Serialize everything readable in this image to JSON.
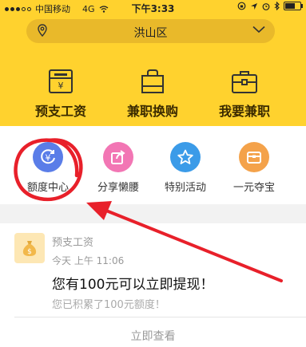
{
  "status_bar": {
    "carrier": "中国移动",
    "network": "4G",
    "time": "下午3:33"
  },
  "location": {
    "name": "洪山区"
  },
  "top_entries": [
    {
      "label": "预支工资",
      "icon": "wallet-icon"
    },
    {
      "label": "兼职换购",
      "icon": "shopping-bag-icon"
    },
    {
      "label": "我要兼职",
      "icon": "briefcase-icon"
    }
  ],
  "circle_entries": [
    {
      "label": "额度中心",
      "icon": "yen-refresh-icon",
      "color": "#5a7de8"
    },
    {
      "label": "分享懒腰",
      "icon": "share-icon",
      "color": "#f276b4"
    },
    {
      "label": "特别活动",
      "icon": "star-icon",
      "color": "#3b9be8"
    },
    {
      "label": "一元夺宝",
      "icon": "treasure-icon",
      "color": "#f4a24a"
    }
  ],
  "message": {
    "title": "预支工资",
    "time": "今天 上午 11:06",
    "headline": "您有100元可以立即提现！",
    "sub": "您已积累了100元额度！",
    "action": "立即查看"
  },
  "colors": {
    "brand_yellow": "#ffd22e",
    "annotation_red": "#e8202a"
  }
}
